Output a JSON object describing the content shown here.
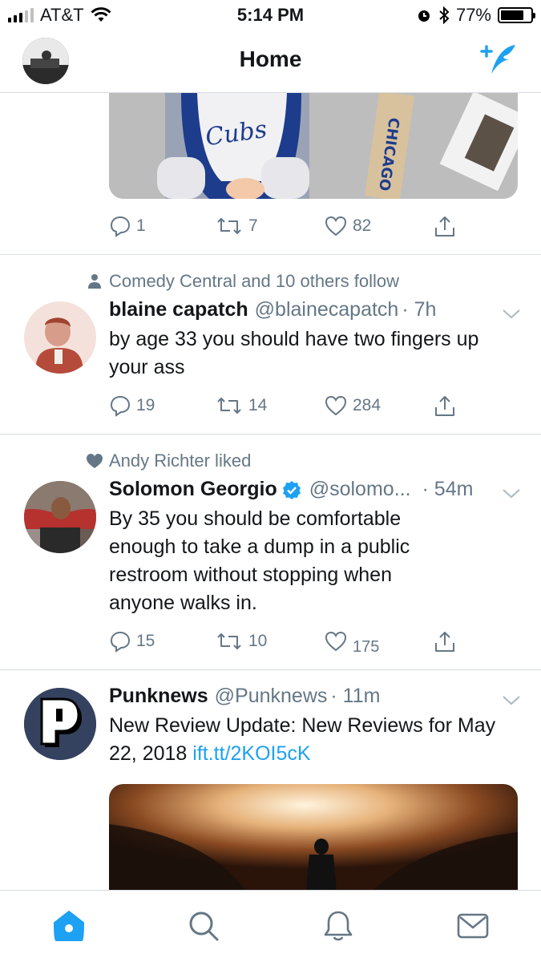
{
  "status_bar": {
    "carrier": "AT&T",
    "time": "5:14 PM",
    "battery": "77%",
    "battery_level": 0.77
  },
  "header": {
    "title": "Home",
    "compose_icon": "compose-tweet-icon"
  },
  "tweets": [
    {
      "actions": {
        "replies": "1",
        "retweets": "7",
        "likes": "82"
      }
    },
    {
      "social_context": "Comedy Central and 10 others follow",
      "social_icon": "person-icon",
      "name": "blaine capatch",
      "handle": "@blainecapatch",
      "time": "· 7h",
      "text": "by age 33 you should have two fingers up your ass",
      "actions": {
        "replies": "19",
        "retweets": "14",
        "likes": "284"
      }
    },
    {
      "social_context": "Andy Richter liked",
      "social_icon": "heart-icon",
      "name": "Solomon Georgio",
      "verified": true,
      "handle": "@solomo...",
      "time": "· 54m",
      "text": "By 35 you should be comfortable enough to take a dump in a public restroom without stopping when anyone walks in.",
      "actions": {
        "replies": "15",
        "retweets": "10",
        "likes_old": "---",
        "likes": "175"
      }
    },
    {
      "name": "Punknews",
      "handle": "@Punknews",
      "time": "· 11m",
      "text": "New Review Update: New Reviews for May 22, 2018",
      "link": "ift.tt/2KOI5cK"
    }
  ],
  "tab_bar": {
    "tabs": [
      "home-icon",
      "search-icon",
      "notifications-icon",
      "messages-icon"
    ],
    "active": "home-icon"
  },
  "colors": {
    "accent": "#1da1f2",
    "secondary_text": "#657786",
    "divider": "#d8dde2"
  }
}
